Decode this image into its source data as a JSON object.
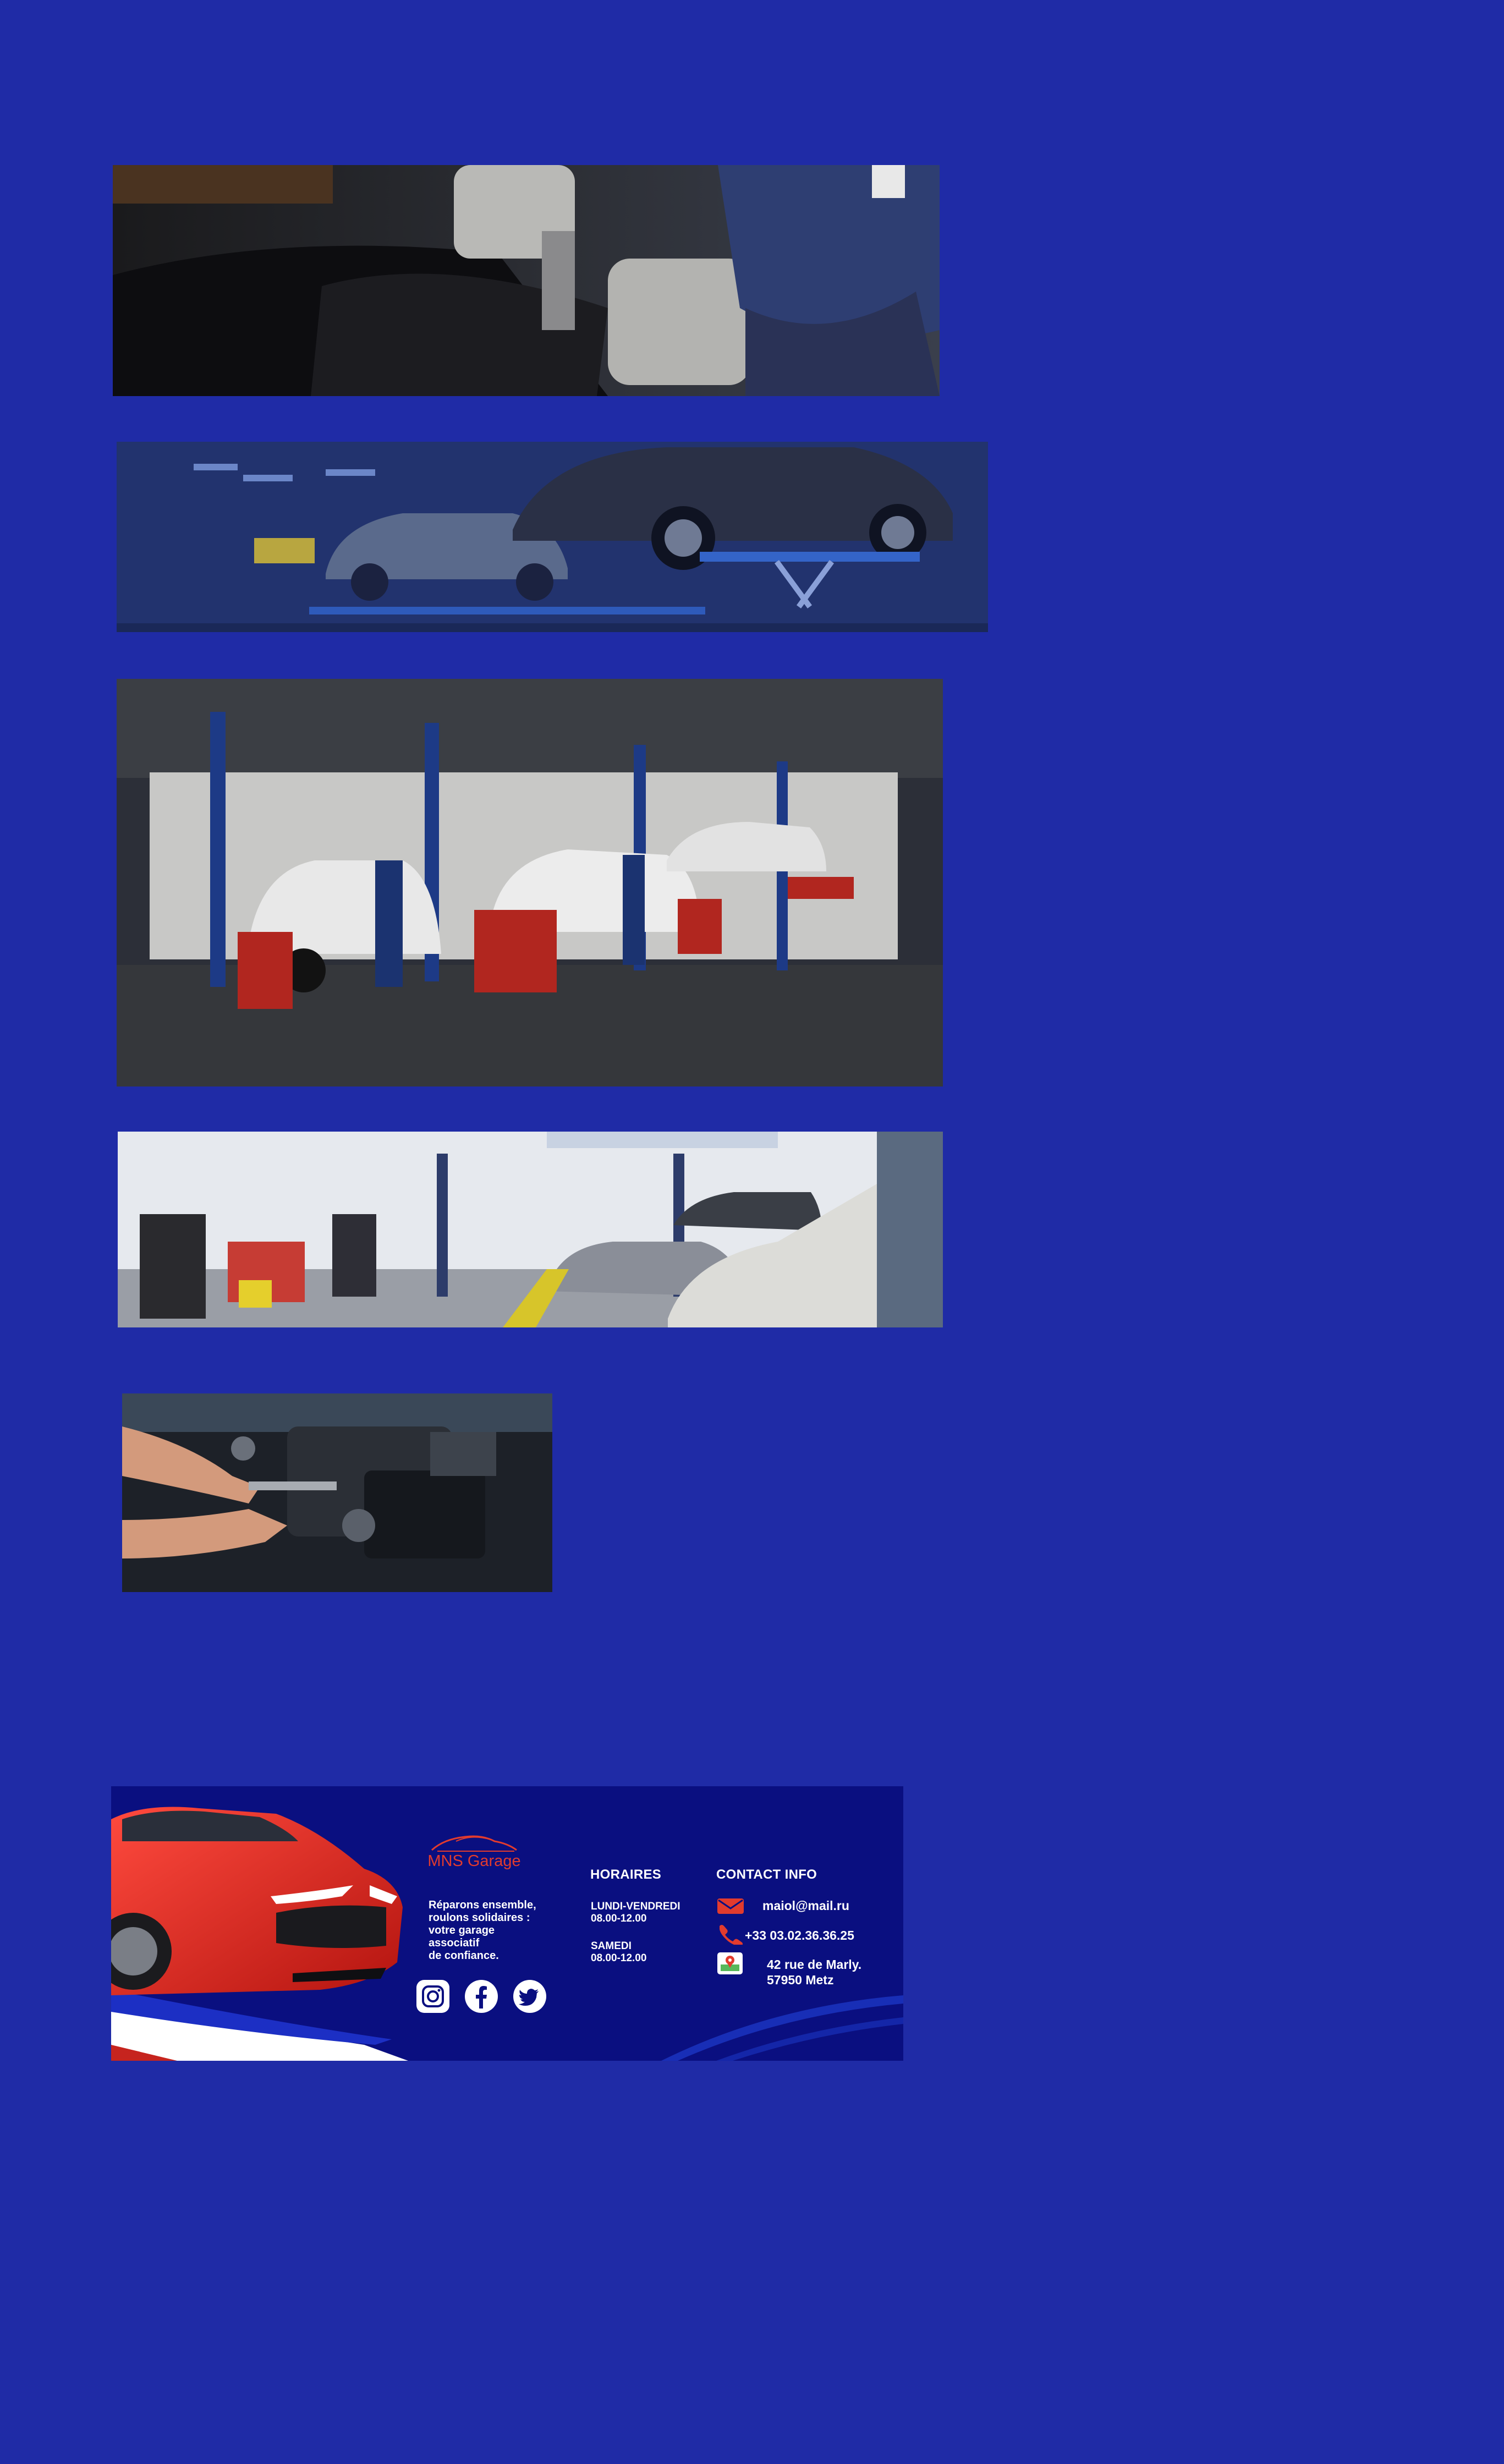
{
  "colors": {
    "page_background": "#1f2ba6",
    "footer_background": "#0a0f80",
    "brand_red": "#e23b2e",
    "text_white": "#ffffff"
  },
  "images": [
    {
      "name": "mechanic-wrench-engine-photo"
    },
    {
      "name": "cars-on-lifts-garage-photo"
    },
    {
      "name": "garage-workshop-mechanics-photo"
    },
    {
      "name": "service-bay-vans-photo"
    },
    {
      "name": "hands-repairing-engine-photo"
    }
  ],
  "footer": {
    "brand_name": "MNS Garage",
    "tagline": "Réparons ensemble,\n roulons solidaires :\nvotre garage\nassociatif\nde confiance.",
    "social_icons": [
      "instagram-icon",
      "facebook-icon",
      "twitter-icon"
    ],
    "hours": {
      "title": "HORAIRES",
      "weekdays_label": "LUNDI-VENDREDI",
      "weekdays_time": "08.00-12.00",
      "saturday_label": "SAMEDI",
      "saturday_time": "08.00-12.00"
    },
    "contact": {
      "title": "CONTACT INFO",
      "email": "maiol@mail.ru",
      "phone": "+33 03.02.36.36.25",
      "address_line1": "42 rue de Marly.",
      "address_line2": "57950 Metz"
    }
  }
}
